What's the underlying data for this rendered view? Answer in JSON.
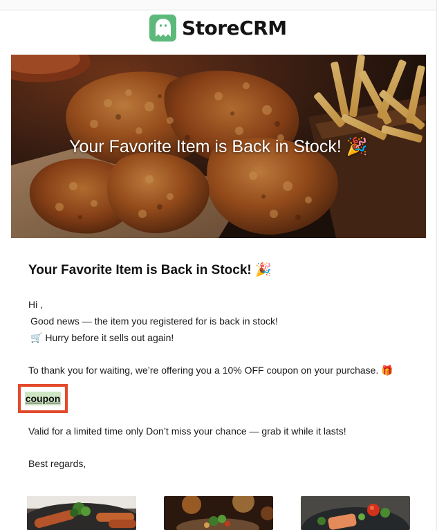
{
  "header": {
    "brand_name": "StoreCRM",
    "logo_icon": "ghost-icon",
    "brand_color": "#5cb97a"
  },
  "hero": {
    "title": "Your Favorite Item is Back in Stock! 🎉",
    "image": "fried-chicken-photo"
  },
  "email": {
    "heading": "Your Favorite Item is Back in Stock! 🎉",
    "greeting": "Hi ,",
    "news": "Good news — the item you registered for is back in stock!",
    "hurry": "🛒 Hurry before it sells out again!",
    "thanks": "To thank you for waiting, we’re offering you a 10% OFF coupon on your purchase. 🎁",
    "coupon_label": "coupon",
    "valid": "Valid for a limited time only Don’t miss your chance — grab it while it lasts!",
    "regards": "Best regards,"
  },
  "highlight": {
    "color": "#e24a2b",
    "coupon_bg": "#cfe6c4"
  },
  "products": [
    {
      "image": "sausage-salad-photo"
    },
    {
      "image": "restaurant-dish-photo"
    },
    {
      "image": "salmon-bowl-photo"
    }
  ]
}
